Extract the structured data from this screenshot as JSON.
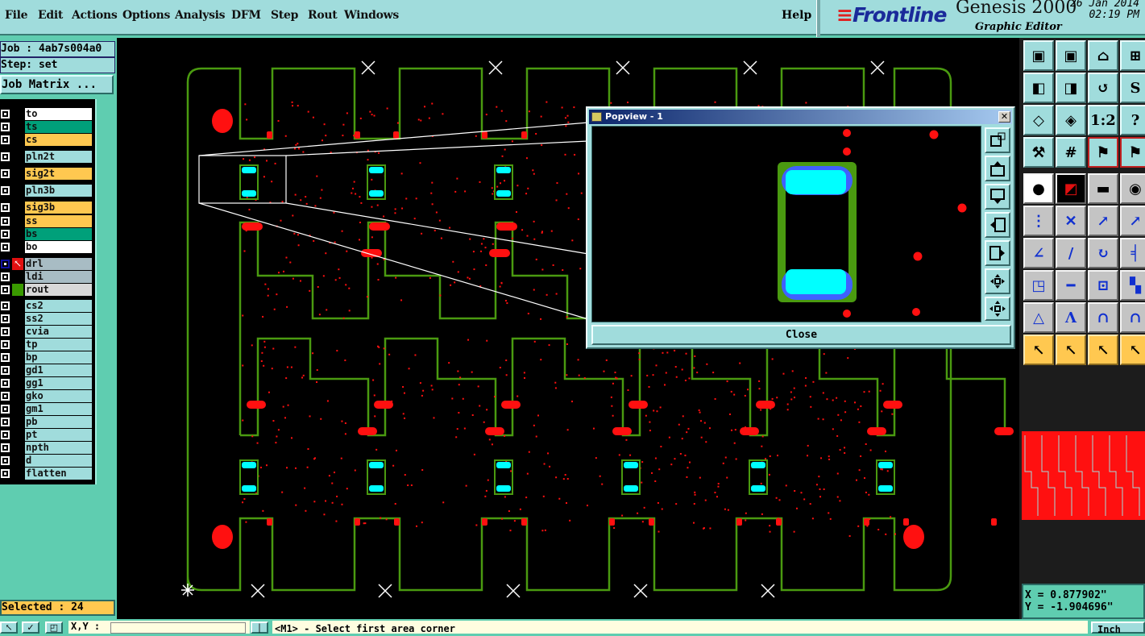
{
  "menu": {
    "items": [
      "File",
      "Edit",
      "Actions",
      "Options",
      "Analysis",
      "DFM",
      "Step",
      "Rout",
      "Windows"
    ],
    "help": "Help"
  },
  "brand": {
    "logo": "Frontline",
    "product": "Genesis 2000",
    "subtitle": "Graphic Editor",
    "date": "26 Jan 2014",
    "time": "02:19 PM"
  },
  "job": {
    "job_label": "Job : 4ab7s004a0",
    "step_label": "Step: set",
    "matrix_button": "Job Matrix ..."
  },
  "layers": [
    {
      "name": "to",
      "color": "#ffffff"
    },
    {
      "name": "ts",
      "color": "#00a07a"
    },
    {
      "name": "cs",
      "color": "#ffc850"
    },
    {
      "name": "pln2t",
      "color": "#a0dcdc"
    },
    {
      "name": "sig2t",
      "color": "#ffc850"
    },
    {
      "name": "pln3b",
      "color": "#a0dcdc"
    },
    {
      "name": "sig3b",
      "color": "#ffc850"
    },
    {
      "name": "ss",
      "color": "#ffc850"
    },
    {
      "name": "bs",
      "color": "#00a07a"
    },
    {
      "name": "bo",
      "color": "#ffffff"
    },
    {
      "name": "drl",
      "color": "#a8bcc4",
      "active": true
    },
    {
      "name": "ldi",
      "color": "#a8bcc4"
    },
    {
      "name": "rout",
      "color": "#d8d8d8",
      "feature_color": "#3a9a00"
    },
    {
      "name": "cs2",
      "color": "#a0dcdc"
    },
    {
      "name": "ss2",
      "color": "#a0dcdc"
    },
    {
      "name": "cvia",
      "color": "#a0dcdc"
    },
    {
      "name": "tp",
      "color": "#a0dcdc"
    },
    {
      "name": "bp",
      "color": "#a0dcdc"
    },
    {
      "name": "gd1",
      "color": "#a0dcdc"
    },
    {
      "name": "gg1",
      "color": "#a0dcdc"
    },
    {
      "name": "gko",
      "color": "#a0dcdc"
    },
    {
      "name": "gm1",
      "color": "#a0dcdc"
    },
    {
      "name": "pb",
      "color": "#a0dcdc"
    },
    {
      "name": "pt",
      "color": "#a0dcdc"
    },
    {
      "name": "npth",
      "color": "#a0dcdc"
    },
    {
      "name": "d",
      "color": "#a0dcdc"
    },
    {
      "name": "flatten",
      "color": "#a0dcdc"
    }
  ],
  "selected": "Selected : 24",
  "coords": {
    "x": "X = 0.877902\"",
    "y": "Y = -1.904696\""
  },
  "bottom": {
    "xy_label": "X,Y :",
    "xy_value": "",
    "prompt": "<M1> - Select first area corner",
    "units": "Inch"
  },
  "popview": {
    "title": "Popview - 1",
    "close": "Close"
  },
  "colors": {
    "profile": "#4a9a10",
    "drill": "#ff1010",
    "pad": "#00ffff",
    "canvas": "#000000"
  },
  "toolbar_icons": [
    "zoom-in-layer",
    "zoom-out-layer",
    "home",
    "grid-xy",
    "pan-left",
    "pan-right",
    "undo-view",
    "snake",
    "zoom-fit",
    "zoom-center",
    "ratio-1-2",
    "help",
    "tools",
    "grid",
    "net-highlight",
    "net-highlight-2",
    "select-feature",
    "area-select",
    "ruler",
    "pad",
    "connect-nodes",
    "delete-node",
    "move-node",
    "move-node-filled",
    "angle-measure",
    "line-measure",
    "rotate",
    "mirror",
    "copy-move",
    "line-split",
    "dimension",
    "merge",
    "triangle-measure",
    "arc-measure",
    "arch-measure",
    "arch-cross",
    "pointer",
    "pointer-box",
    "pointer-polygon",
    "pointer-route"
  ]
}
